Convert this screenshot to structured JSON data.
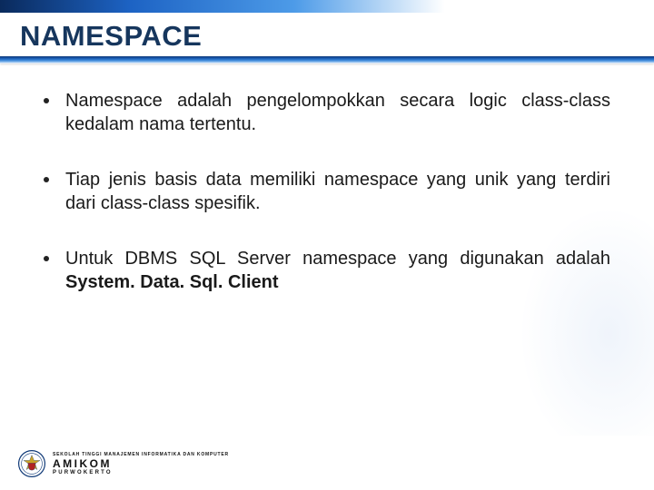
{
  "title": "NAMESPACE",
  "bullets": [
    {
      "text": "Namespace adalah pengelompokkan secara  logic class-class kedalam nama tertentu."
    },
    {
      "text": "Tiap jenis basis data memiliki  namespace yang unik yang terdiri dari class-class spesifik."
    },
    {
      "prefix": "Untuk DBMS SQL Server namespace yang digunakan adalah ",
      "bold": "System. Data. Sql. Client"
    }
  ],
  "footer": {
    "line1": "SEKOLAH TINGGI MANAJEMEN INFORMATIKA DAN KOMPUTER",
    "line2": "AMIKOM",
    "line3": "PURWOKERTO"
  }
}
